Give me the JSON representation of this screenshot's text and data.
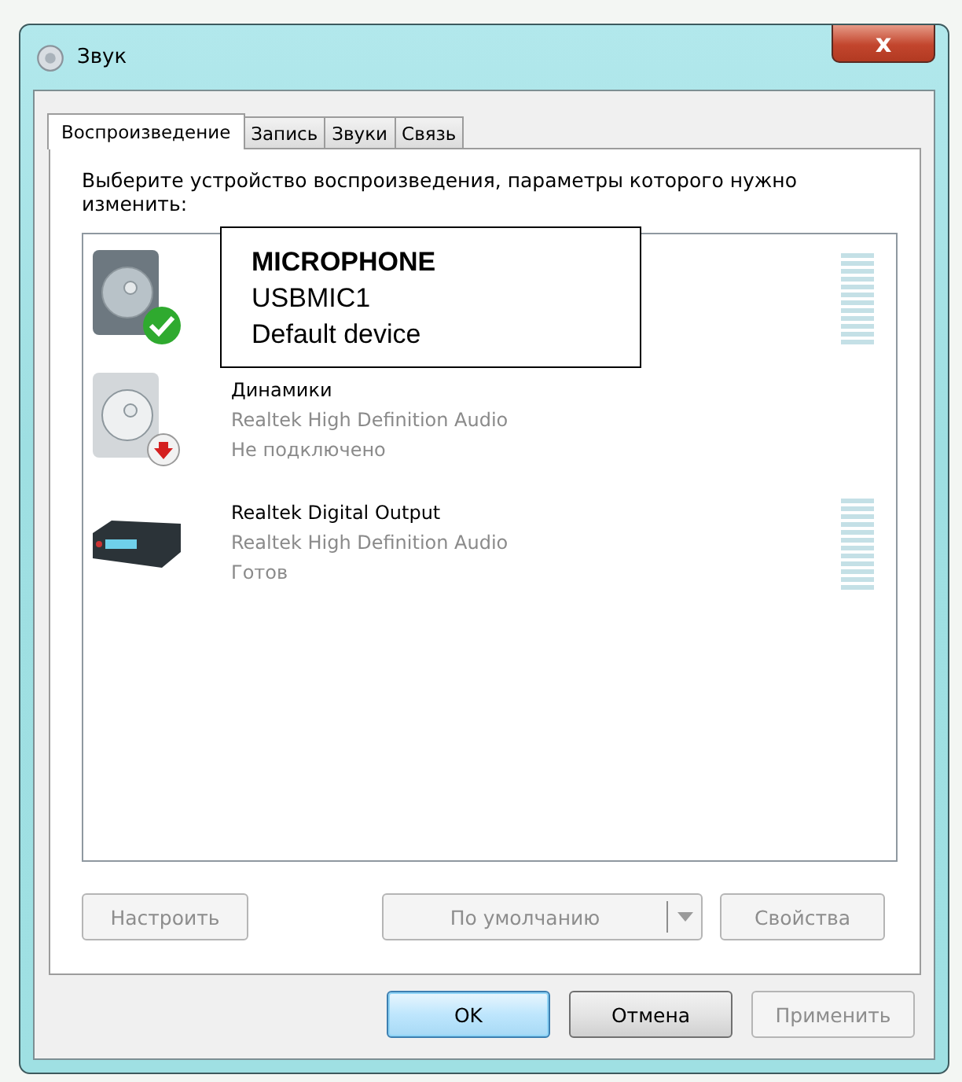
{
  "window": {
    "title": "Звук",
    "close": "x"
  },
  "tabs": [
    {
      "label": "Воспроизведение",
      "selected": true
    },
    {
      "label": "Запись",
      "selected": false
    },
    {
      "label": "Звуки",
      "selected": false
    },
    {
      "label": "Связь",
      "selected": false
    }
  ],
  "instruction": "Выберите устройство воспроизведения, параметры которого нужно изменить:",
  "devices": [
    {
      "kind": "default_speaker",
      "meter": true
    },
    {
      "kind": "disconnected_speaker",
      "name": "Динамики",
      "driver": "Realtek High Definition Audio",
      "status": "Не подключено"
    },
    {
      "kind": "receiver",
      "meter": true,
      "name": "Realtek Digital Output",
      "driver": "Realtek High Definition Audio",
      "status": "Готов"
    }
  ],
  "tooltip": {
    "title": "MICROPHONE",
    "lines": [
      "USBMIC1",
      "Default device"
    ]
  },
  "list_buttons": [
    {
      "label": "Настроить",
      "disabled": true,
      "split": false
    },
    {
      "label": "По умолчанию",
      "disabled": true,
      "split": true
    },
    {
      "label": "Свойства",
      "disabled": true,
      "split": false
    }
  ],
  "dialog_buttons": [
    {
      "label": "OK",
      "disabled": false,
      "default": true
    },
    {
      "label": "Отмена",
      "disabled": false,
      "default": false
    },
    {
      "label": "Применить",
      "disabled": true,
      "default": false
    }
  ]
}
